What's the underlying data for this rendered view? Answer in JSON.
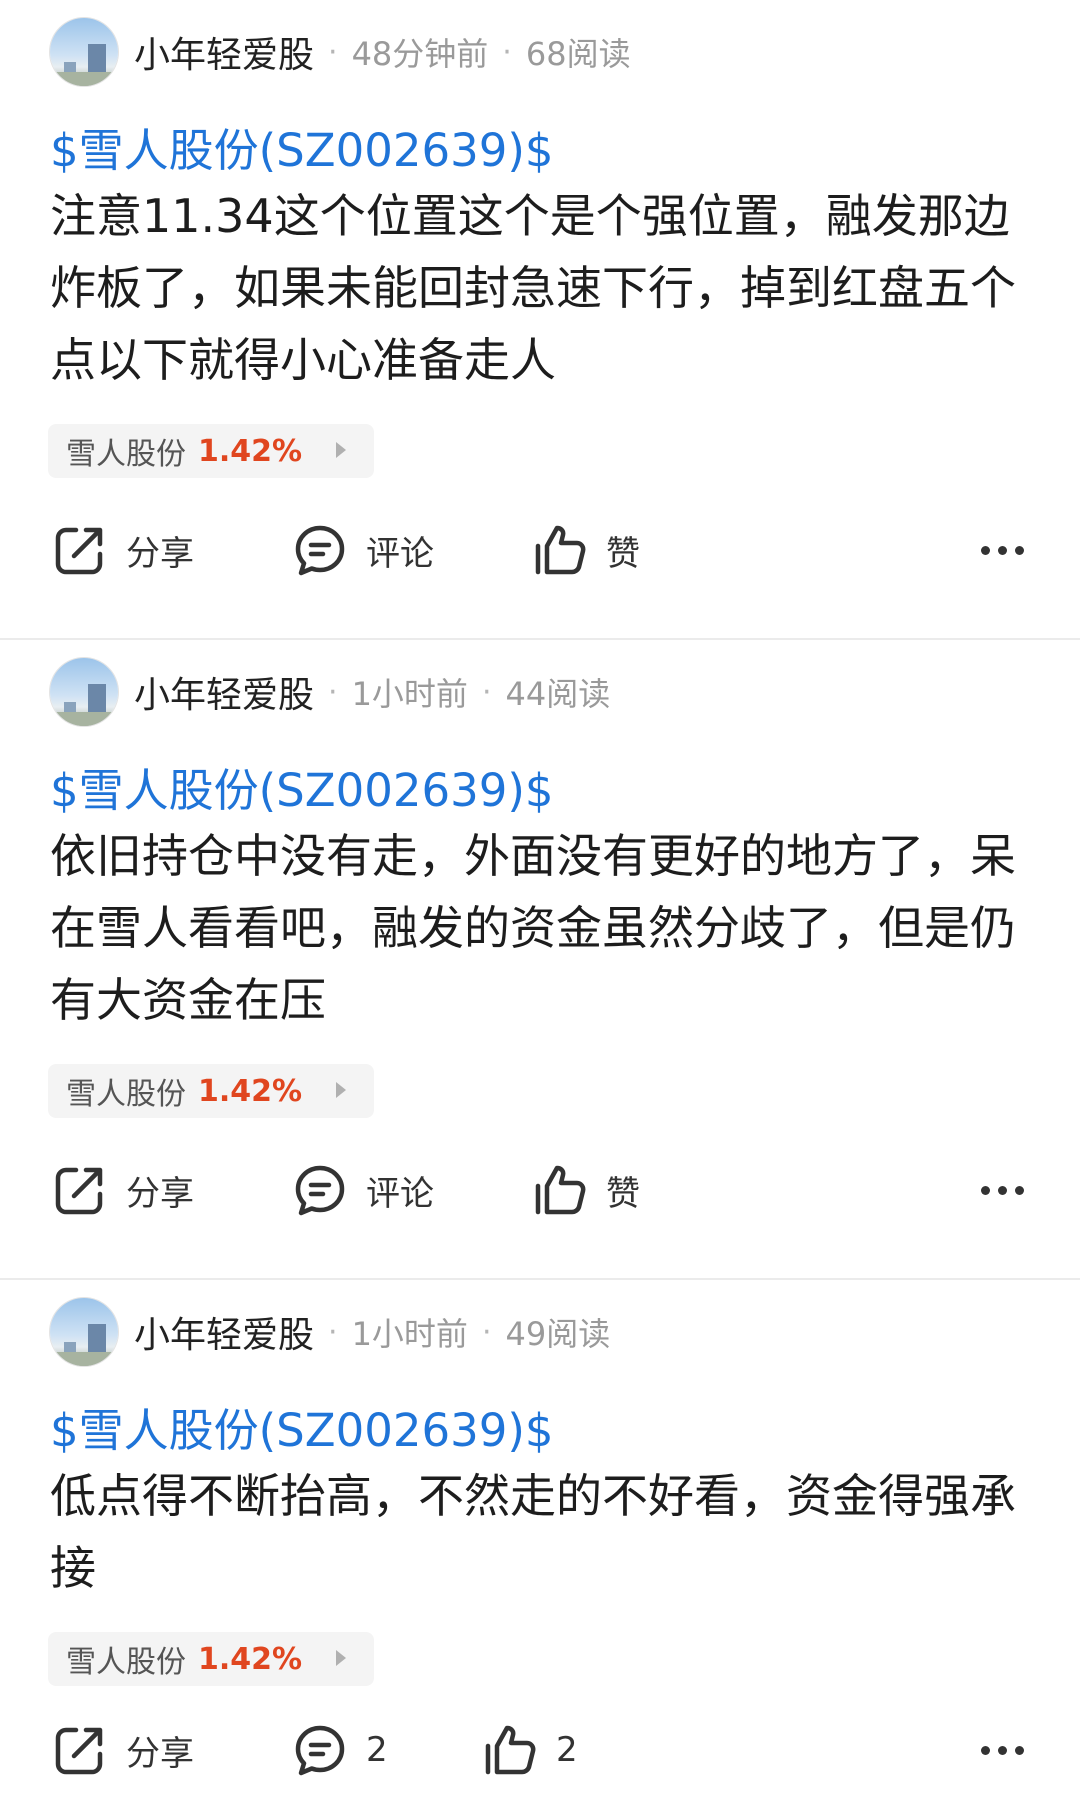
{
  "posts": [
    {
      "username": "小年轻爱股",
      "time": "48分钟前",
      "reads": "68阅读",
      "stock_link": "$雪人股份(SZ002639)$",
      "content": "注意11.34这个位置这个是个强位置，融发那边炸板了，如果未能回封急速下行，掉到红盘五个点以下就得小心准备走人",
      "stock_tag": {
        "name": "雪人股份",
        "change": "1.42%"
      },
      "actions": {
        "share": "分享",
        "comment": "评论",
        "like": "赞"
      }
    },
    {
      "username": "小年轻爱股",
      "time": "1小时前",
      "reads": "44阅读",
      "stock_link": "$雪人股份(SZ002639)$",
      "content": "依旧持仓中没有走，外面没有更好的地方了，呆在雪人看看吧，融发的资金虽然分歧了，但是仍有大资金在压",
      "stock_tag": {
        "name": "雪人股份",
        "change": "1.42%"
      },
      "actions": {
        "share": "分享",
        "comment": "评论",
        "like": "赞"
      }
    },
    {
      "username": "小年轻爱股",
      "time": "1小时前",
      "reads": "49阅读",
      "stock_link": "$雪人股份(SZ002639)$",
      "content": "低点得不断抬高，不然走的不好看，资金得强承接",
      "stock_tag": {
        "name": "雪人股份",
        "change": "1.42%"
      },
      "actions": {
        "share": "分享",
        "comment": "2",
        "like": "2"
      }
    }
  ],
  "icons": {
    "share": "share-icon",
    "comment": "comment-icon",
    "like": "thumbs-up-icon",
    "more": "more-icon",
    "tag_arrow": "triangle-right-icon"
  },
  "colors": {
    "stock_link": "#1f74d8",
    "change_up": "#e0461f",
    "meta": "#9a9a9a",
    "tag_bg": "#f4f4f4"
  }
}
